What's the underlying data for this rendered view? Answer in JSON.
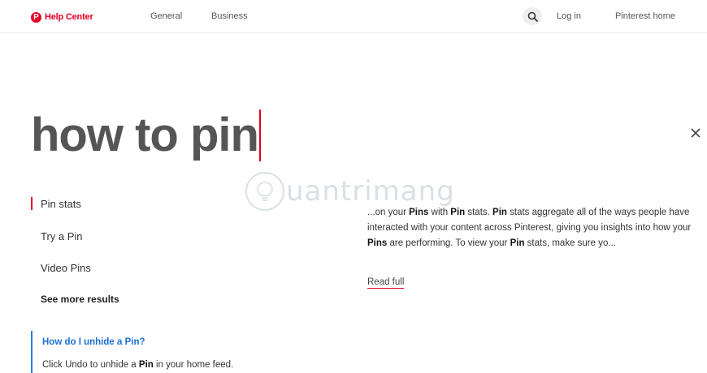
{
  "header": {
    "brand": {
      "logo_glyph": "P",
      "label": "Help Center",
      "color": "#e60023"
    },
    "nav": [
      "General",
      "Business"
    ],
    "search_icon": "search-icon",
    "login_label": "Log in",
    "home_label": "Pinterest home"
  },
  "search": {
    "query": "how to pin",
    "close_icon": "close-icon"
  },
  "results": {
    "items": [
      {
        "label": "Pin stats",
        "active": true
      },
      {
        "label": "Try a Pin",
        "active": false
      },
      {
        "label": "Video Pins",
        "active": false
      }
    ],
    "see_more": "See more results"
  },
  "preview": {
    "segments": [
      {
        "t": "...on your ",
        "b": false
      },
      {
        "t": "Pins",
        "b": true
      },
      {
        "t": " with ",
        "b": false
      },
      {
        "t": "Pin",
        "b": true
      },
      {
        "t": " stats. ",
        "b": false
      },
      {
        "t": "Pin",
        "b": true
      },
      {
        "t": " stats aggregate all of the ways people have interacted with your content across Pinterest, giving you insights into how your ",
        "b": false
      },
      {
        "t": "Pins",
        "b": true
      },
      {
        "t": " are performing. To view your ",
        "b": false
      },
      {
        "t": "Pin",
        "b": true
      },
      {
        "t": " stats, make sure yo...",
        "b": false
      }
    ],
    "read_full": "Read full"
  },
  "watermark": {
    "text": "uantrimang"
  },
  "faq": {
    "question": "How do I unhide a Pin?",
    "answer_before": "Click Undo to unhide a ",
    "answer_bold": "Pin",
    "answer_after": " in your home feed."
  },
  "colors": {
    "accent": "#e60023",
    "link_blue": "#1a6fd6"
  }
}
